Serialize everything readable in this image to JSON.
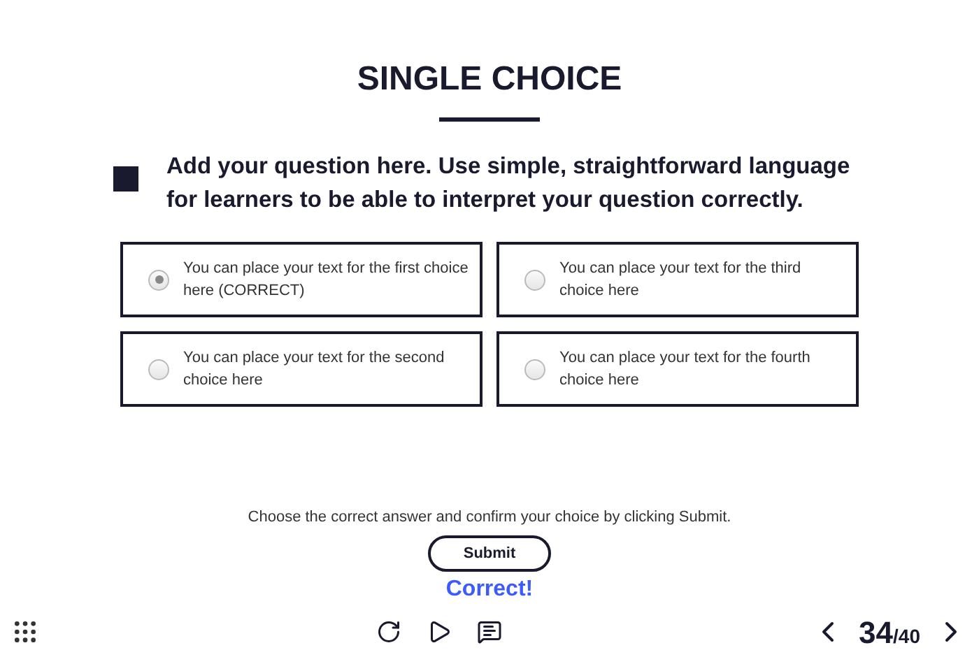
{
  "title": "SINGLE CHOICE",
  "question": "Add your question here. Use simple, straightforward language for learners to be able to interpret your question correctly.",
  "choices": [
    {
      "text": "You can place your text for the first choice here (CORRECT)",
      "selected": true
    },
    {
      "text": "You can place your text for the third choice here",
      "selected": false
    },
    {
      "text": "You can place your text for the second choice here",
      "selected": false
    },
    {
      "text": "You can place your text for the fourth choice here",
      "selected": false
    }
  ],
  "instruction": "Choose the correct answer and confirm your choice by clicking Submit.",
  "submit": "Submit",
  "feedback": "Correct!",
  "page": {
    "current": "34",
    "total": "/40"
  }
}
